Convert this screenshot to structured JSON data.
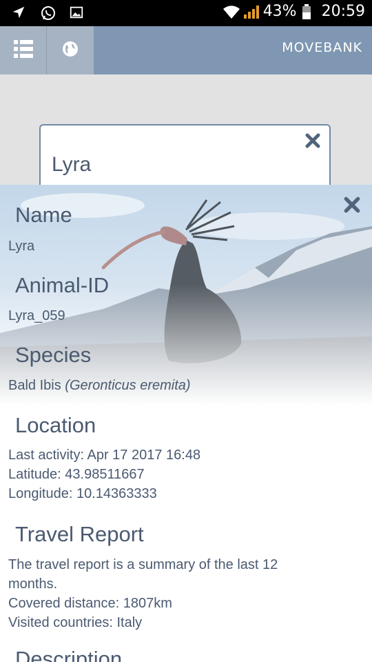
{
  "status_bar": {
    "battery_percent": "43%",
    "time": "20:59"
  },
  "app_bar": {
    "brand": "MOVEBANK"
  },
  "search": {
    "value": "Lyra"
  },
  "details": {
    "name_heading": "Name",
    "name_value": "Lyra",
    "animal_id_heading": "Animal-ID",
    "animal_id_value": "Lyra_059",
    "species_heading": "Species",
    "species_common": "Bald Ibis",
    "species_scientific": "(Geronticus eremita)",
    "location_heading": "Location",
    "last_activity": "Last activity: Apr 17 2017 16:48",
    "latitude": "Latitude: 43.98511667",
    "longitude": "Longitude: 10.14363333",
    "travel_heading": "Travel Report",
    "travel_summary_line1": "The travel report is a summary of the last 12",
    "travel_summary_line2": "months.",
    "covered_distance": "Covered distance: 1807km",
    "visited_countries": "Visited countries: Italy",
    "description_heading": "Description"
  }
}
